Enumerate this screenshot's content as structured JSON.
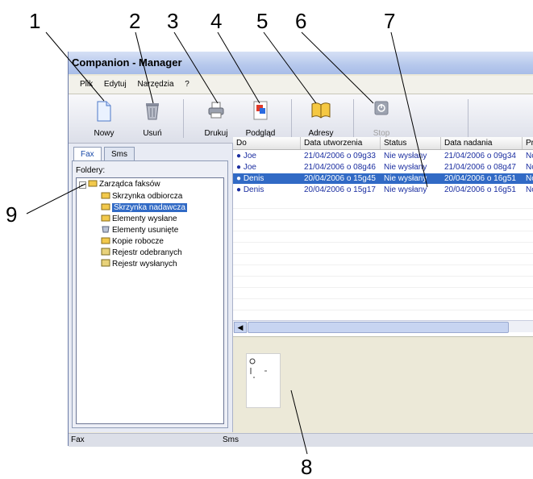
{
  "callouts": [
    "1",
    "2",
    "3",
    "4",
    "5",
    "6",
    "7",
    "8",
    "9"
  ],
  "window": {
    "title": "Companion - Manager",
    "menu": [
      "Plik",
      "Edytuj",
      "Narzędzia",
      "?"
    ],
    "toolbar": [
      {
        "label": "Nowy",
        "icon": "new-document-icon",
        "enabled": true
      },
      {
        "label": "Usuń",
        "icon": "trash-icon",
        "enabled": true
      },
      {
        "label": "Drukuj",
        "icon": "printer-icon",
        "enabled": true
      },
      {
        "label": "Podgląd",
        "icon": "preview-icon",
        "enabled": true
      },
      {
        "label": "Adresy",
        "icon": "address-book-icon",
        "enabled": true
      },
      {
        "label": "Stop",
        "icon": "stop-icon",
        "enabled": false
      }
    ],
    "tabs": [
      "Fax",
      "Sms"
    ],
    "active_tab": "Fax",
    "folders_label": "Foldery:",
    "tree": {
      "root": "Zarządca faksów",
      "items": [
        "Skrzynka odbiorcza",
        "Skrzynka nadawcza",
        "Elementy wysłane",
        "Elementy usunięte",
        "Kopie robocze",
        "Rejestr odebranych",
        "Rejestr wysłanych"
      ],
      "selected": "Skrzynka nadawcza"
    },
    "columns": [
      "Do",
      "Data utworzenia",
      "Status",
      "Data nadania",
      "Pri"
    ],
    "rows": [
      [
        "Joe",
        "21/04/2006 o 09g33",
        "Nie wysłany",
        "21/04/2006 o 09g34",
        "No"
      ],
      [
        "Joe",
        "21/04/2006 o 08g46",
        "Nie wysłany",
        "21/04/2006 o 08g47",
        "No"
      ],
      [
        "Denis",
        "20/04/2006 o 15g45",
        "Nie wysłany",
        "20/04/2006 o 16g51",
        "No"
      ],
      [
        "Denis",
        "20/04/2006 o 15g17",
        "Nie wysłany",
        "20/04/2006 o 16g51",
        "No"
      ]
    ],
    "selected_row": 2,
    "status": {
      "left": "Fax",
      "right": "Sms"
    },
    "colors": {
      "selection": "#316ac5",
      "row_text": "#1b2ea0"
    }
  }
}
